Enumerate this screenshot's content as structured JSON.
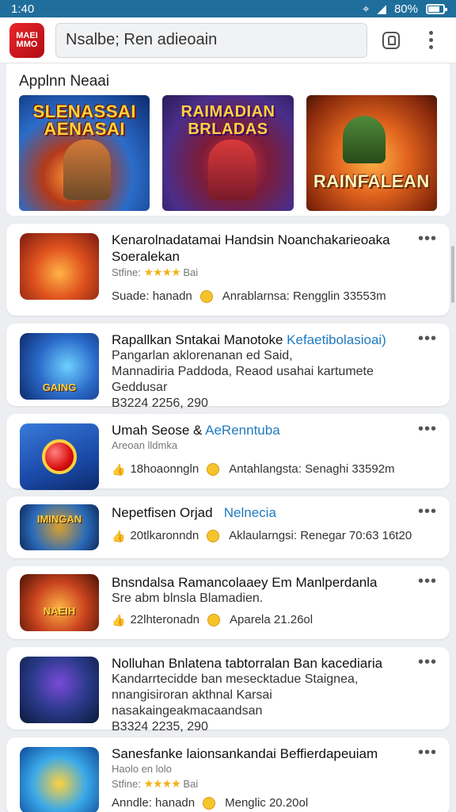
{
  "status": {
    "time": "1:40",
    "battery": "80%"
  },
  "top_bar": {
    "logo_text_1": "MAEI",
    "logo_text_2": "MMO",
    "search_text": "Nsalbe; Ren adieoain"
  },
  "featured": {
    "title": "Applnn Neaai",
    "banners": [
      {
        "line1": "SLENASSAI",
        "line2": "AENASAI"
      },
      {
        "line1": "RAIMADIAN",
        "line2": "BRLADAS"
      },
      {
        "line1": "RAINFALEAN",
        "line2": ""
      }
    ]
  },
  "apps": [
    {
      "title": "Kenarolnadatamai Handsin Noanchakarieoaka Soeralekan",
      "small": "Stfine:",
      "stars": "★★★★",
      "rating": "Bai",
      "meta_left": "Suade: hanadn",
      "meta_right": "Anrablarnsa: Rengglin 33553m"
    },
    {
      "title": "Rapallkan Sntakai Manotoke",
      "accent": "Kefaetibolasioai)",
      "line2": "Pangarlan aklorenanan ed Said,",
      "line3": "Mannadiria Paddoda, Reaod usahai kartumete Geddusar",
      "line4": "B3224 2256, 290",
      "icon_text": "GAING"
    },
    {
      "title": "Umah Seose &",
      "accent": "AeRenntuba",
      "small": "Areoan lldmka",
      "meta_left": "18hoaonngln",
      "meta_right": "Antahlangsta: Senaghi 33592m"
    },
    {
      "title": "Nepetfisen Orjad",
      "accent": "Nelnecia",
      "meta_left": "20tlkaronndn",
      "meta_right": "Aklaularngsi: Renegar 70:63 16t20",
      "icon_text": "IMINGAN"
    },
    {
      "title": "Bnsndalsa Ramancolaaey Em Manlperdanla",
      "line2": "Sre abm blnsla Blamadien.",
      "meta_left": "22lhteronadn",
      "meta_right": "Aparela 21.26ol",
      "icon_text": "NAEIH"
    },
    {
      "title": "Nolluhan Bnlatena tabtorralan Ban kacediaria",
      "line2": "Kandarrtecidde ban mesecktadue Staignea,",
      "line3": "nnangisiroran akthnal Karsai nasakaingeakmacaandsan",
      "line4": "B3324 2235, 290"
    },
    {
      "title": "Sanesfanke laionsankandai Beffierdapeuiam",
      "small": "Haolo en lolo",
      "small2": "Stfine:",
      "stars": "★★★★",
      "rating": "Bai",
      "meta_left": "Anndle: hanadn",
      "meta_right": "Menglic 20.20ol"
    }
  ]
}
